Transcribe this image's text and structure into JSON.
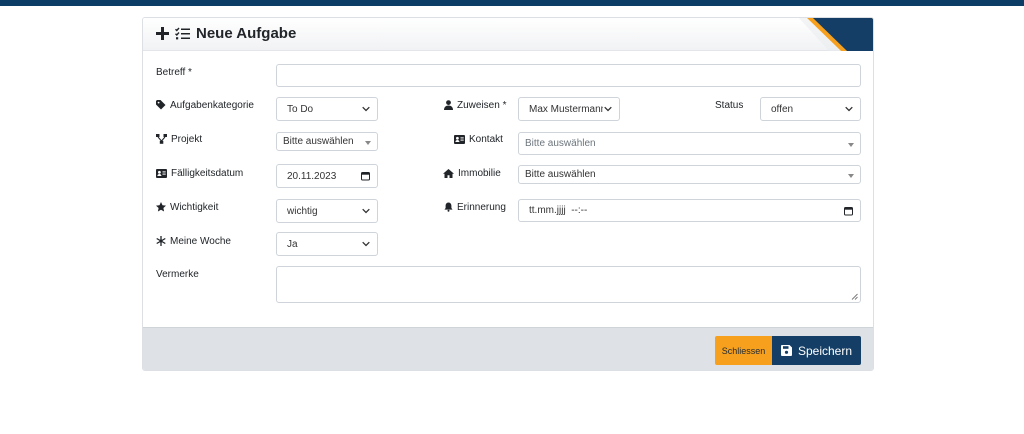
{
  "header": {
    "title": "Neue Aufgabe"
  },
  "form": {
    "betreff": {
      "label": "Betreff *",
      "value": ""
    },
    "aufgabenkategorie": {
      "label": "Aufgabenkategorie",
      "value": "To Do"
    },
    "zuweisen": {
      "label": "Zuweisen *",
      "value": "Max Mustermann"
    },
    "status": {
      "label": "Status",
      "value": "offen"
    },
    "projekt": {
      "label": "Projekt",
      "value": "Bitte auswählen"
    },
    "kontakt": {
      "label": "Kontakt",
      "value": "Bitte auswählen"
    },
    "faelligkeitsdatum": {
      "label": "Fälligkeitsdatum",
      "value": "20.11.2023"
    },
    "immobilie": {
      "label": "Immobilie",
      "value": "Bitte auswählen"
    },
    "wichtigkeit": {
      "label": "Wichtigkeit",
      "value": "wichtig"
    },
    "erinnerung": {
      "label": "Erinnerung",
      "value": "tt.mm.jjjj  --:--"
    },
    "meine_woche": {
      "label": "Meine Woche",
      "value": "Ja"
    },
    "vermerke": {
      "label": "Vermerke",
      "value": ""
    }
  },
  "footer": {
    "close_label": "Schliessen",
    "save_label": "Speichern"
  },
  "colors": {
    "brand_dark": "#143e66",
    "accent_orange": "#f7a01d",
    "footer_bg": "#dee2e6"
  }
}
